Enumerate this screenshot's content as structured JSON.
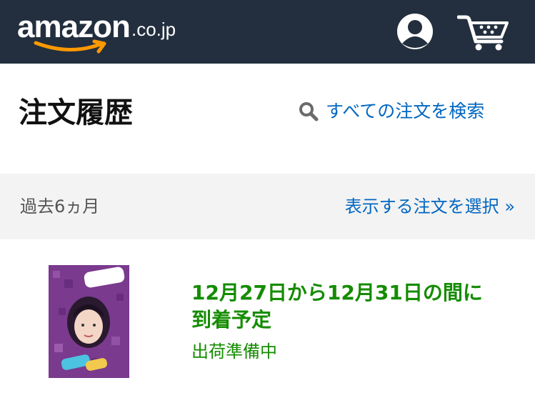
{
  "header": {
    "logo_text": "amazon",
    "logo_suffix": ".co.jp",
    "icons": [
      "account-icon",
      "cart-icon"
    ],
    "background_color": "#232f3e",
    "smile_color": "#ff9900"
  },
  "page": {
    "title": "注文履歴",
    "search_label": "すべての注文を検索",
    "search_icon": "magnifier-icon"
  },
  "filter": {
    "period": "過去6ヵ月",
    "select_label": "表示する注文を選択 »"
  },
  "orders": [
    {
      "delivery_line1": "12月27日から12月31日の間に",
      "delivery_line2": "到着予定",
      "status": "出荷準備中"
    }
  ],
  "colors": {
    "link": "#0066c0",
    "delivery": "#148c00",
    "filter_bg": "#f3f3f3"
  }
}
